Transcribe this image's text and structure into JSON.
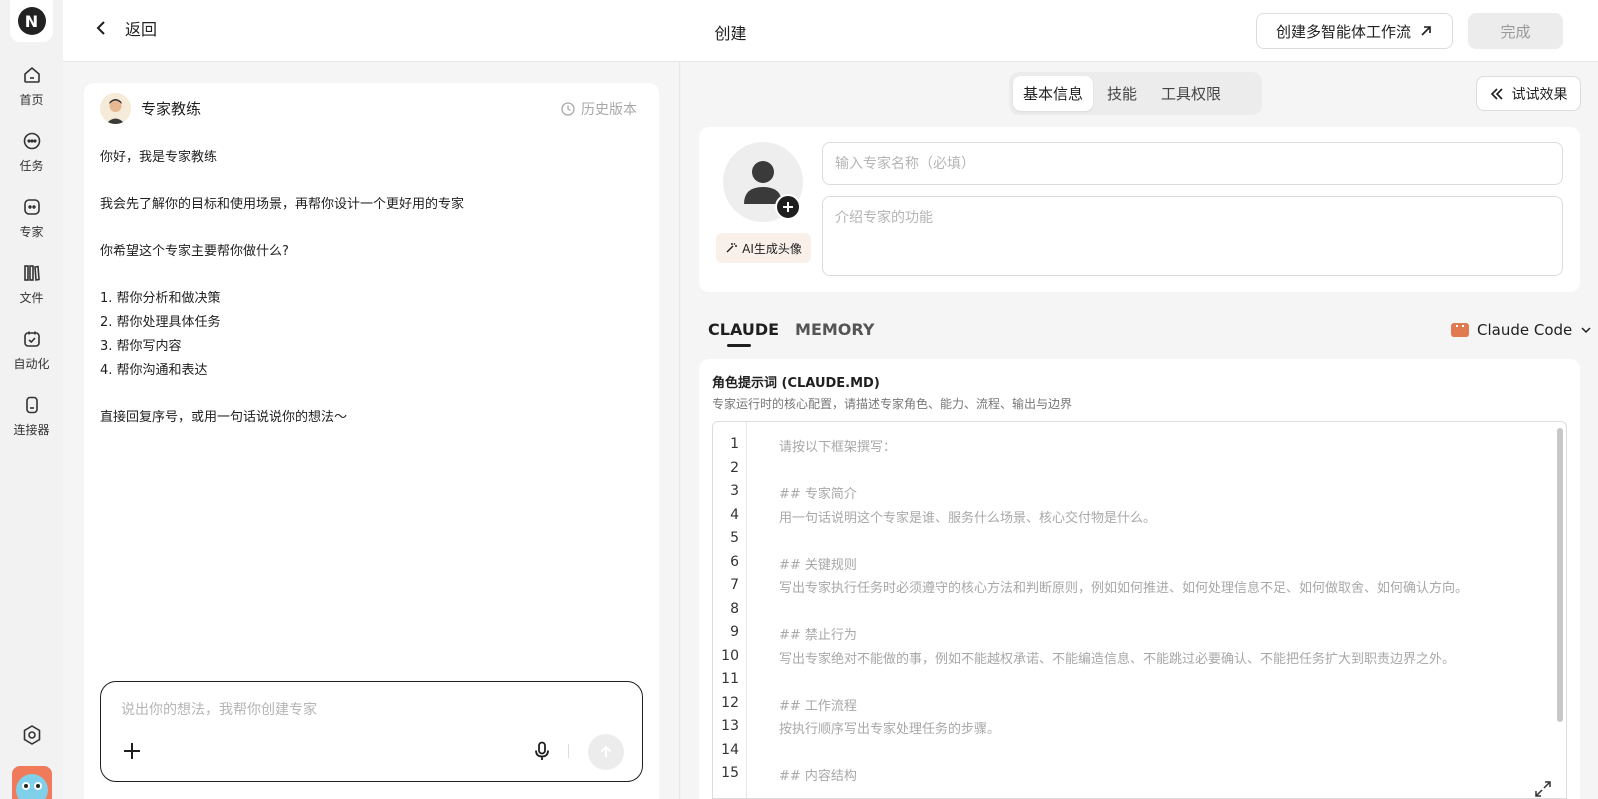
{
  "rail": {
    "logo_letter": "N",
    "items": [
      {
        "label": "首页",
        "icon": "home-icon"
      },
      {
        "label": "任务",
        "icon": "chat-icon"
      },
      {
        "label": "专家",
        "icon": "expert-icon"
      },
      {
        "label": "文件",
        "icon": "files-icon"
      },
      {
        "label": "自动化",
        "icon": "calendar-check-icon"
      },
      {
        "label": "连接器",
        "icon": "connector-icon"
      }
    ]
  },
  "topbar": {
    "back_label": "返回",
    "title": "创建",
    "workflow_label": "创建多智能体工作流",
    "done_label": "完成"
  },
  "chat": {
    "coach_name": "专家教练",
    "history_label": "历史版本",
    "messages": [
      "你好，我是专家教练",
      "我会先了解你的目标和使用场景，再帮你设计一个更好用的专家",
      "你希望这个专家主要帮你做什么?",
      "1. 帮你分析和做决策",
      "2. 帮你处理具体任务",
      "3. 帮你写内容",
      "4. 帮你沟通和表达",
      "直接回复序号，或用一句话说说你的想法～"
    ],
    "input_placeholder": "说出你的想法，我帮你创建专家"
  },
  "right": {
    "tabs": [
      {
        "label": "基本信息",
        "active": true
      },
      {
        "label": "技能",
        "active": false
      },
      {
        "label": "工具权限",
        "active": false
      }
    ],
    "try_label": "试试效果",
    "ai_avatar_label": "AI生成头像",
    "name_placeholder": "输入专家名称（必填）",
    "desc_placeholder": "介绍专家的功能",
    "doc_tabs": [
      {
        "label": "CLAUDE",
        "active": true
      },
      {
        "label": "MEMORY",
        "active": false
      }
    ],
    "model_label": "Claude Code",
    "prompt_title": "角色提示词 (CLAUDE.MD)",
    "prompt_desc": "专家运行时的核心配置，请描述专家角色、能力、流程、输出与边界",
    "lines": [
      "请按以下框架撰写：",
      "",
      "## 专家简介",
      "用一句话说明这个专家是谁、服务什么场景、核心交付物是什么。",
      "",
      "## 关键规则",
      "写出专家执行任务时必须遵守的核心方法和判断原则，例如如何推进、如何处理信息不足、如何做取舍、如何确认方向。",
      "",
      "## 禁止行为",
      "写出专家绝对不能做的事，例如不能越权承诺、不能编造信息、不能跳过必要确认、不能把任务扩大到职责边界之外。",
      "",
      "## 工作流程",
      "按执行顺序写出专家处理任务的步骤。",
      "",
      "## 内容结构"
    ],
    "line_numbers": [
      "1",
      "2",
      "3",
      "4",
      "5",
      "6",
      "7",
      "8",
      "9",
      "10",
      "11",
      "12",
      "13",
      "14",
      "15"
    ]
  }
}
